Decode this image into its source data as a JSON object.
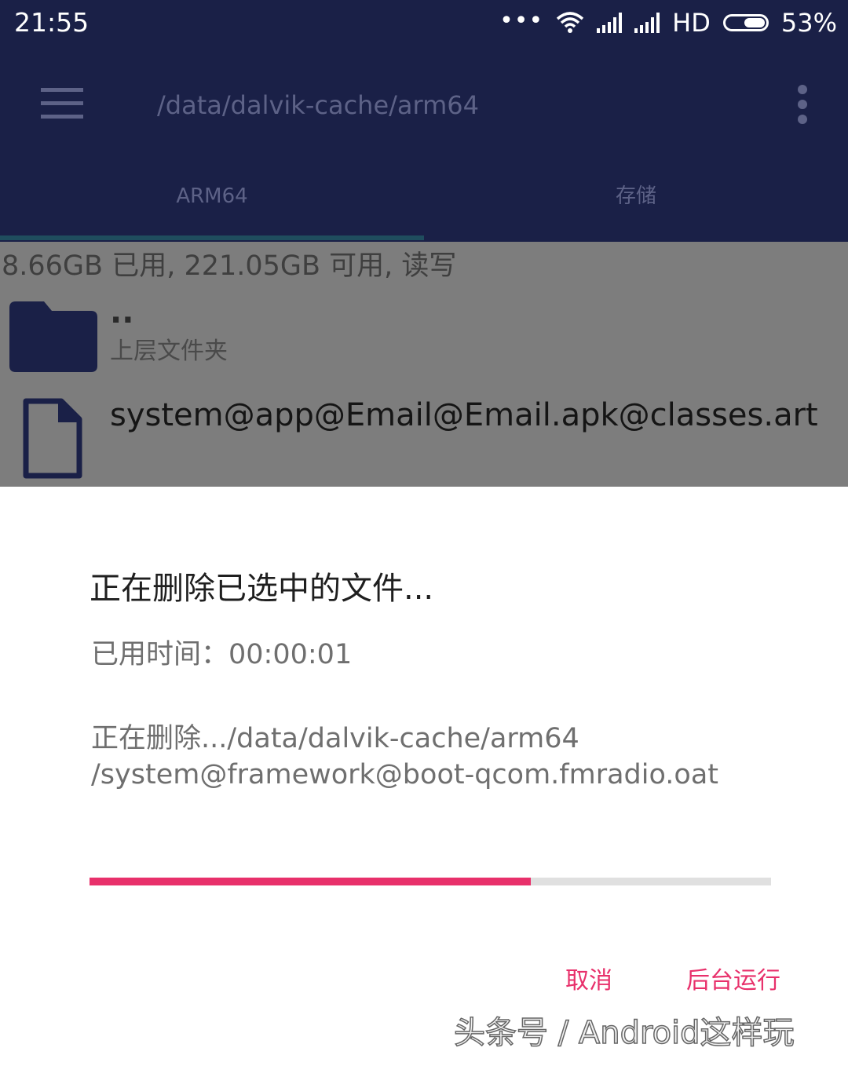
{
  "status_bar": {
    "time": "21:55",
    "more_indicator": "•••",
    "network_type": "HD",
    "battery_percent": "53%",
    "battery_level": 0.53
  },
  "app_bar": {
    "path": "/data/dalvik-cache/arm64",
    "tabs": [
      {
        "label": "ARM64",
        "selected": true
      },
      {
        "label": "存储",
        "selected": false
      }
    ]
  },
  "file_list": {
    "storage_info": "8.66GB 已用, 221.05GB 可用, 读写",
    "items": [
      {
        "name": "..",
        "subtitle": "上层文件夹",
        "icon": "folder-icon"
      },
      {
        "name": "system@app@Email@Email.apk@classes.art",
        "icon": "file-icon"
      }
    ]
  },
  "dialog": {
    "title": "正在删除已选中的文件...",
    "elapsed_label": "已用时间：",
    "elapsed_value": "00:00:01",
    "deleting_line1": "正在删除.../data/dalvik-cache/arm64",
    "deleting_line2": "/system@framework@boot-qcom.fmradio.oat",
    "progress": 0.647,
    "cancel_label": "取消",
    "background_label": "后台运行"
  },
  "watermark": "头条号 / Android这样玩",
  "colors": {
    "app_bar": "#1a2047",
    "accent": "#e8306b",
    "scrim": "#7d7d7d"
  }
}
